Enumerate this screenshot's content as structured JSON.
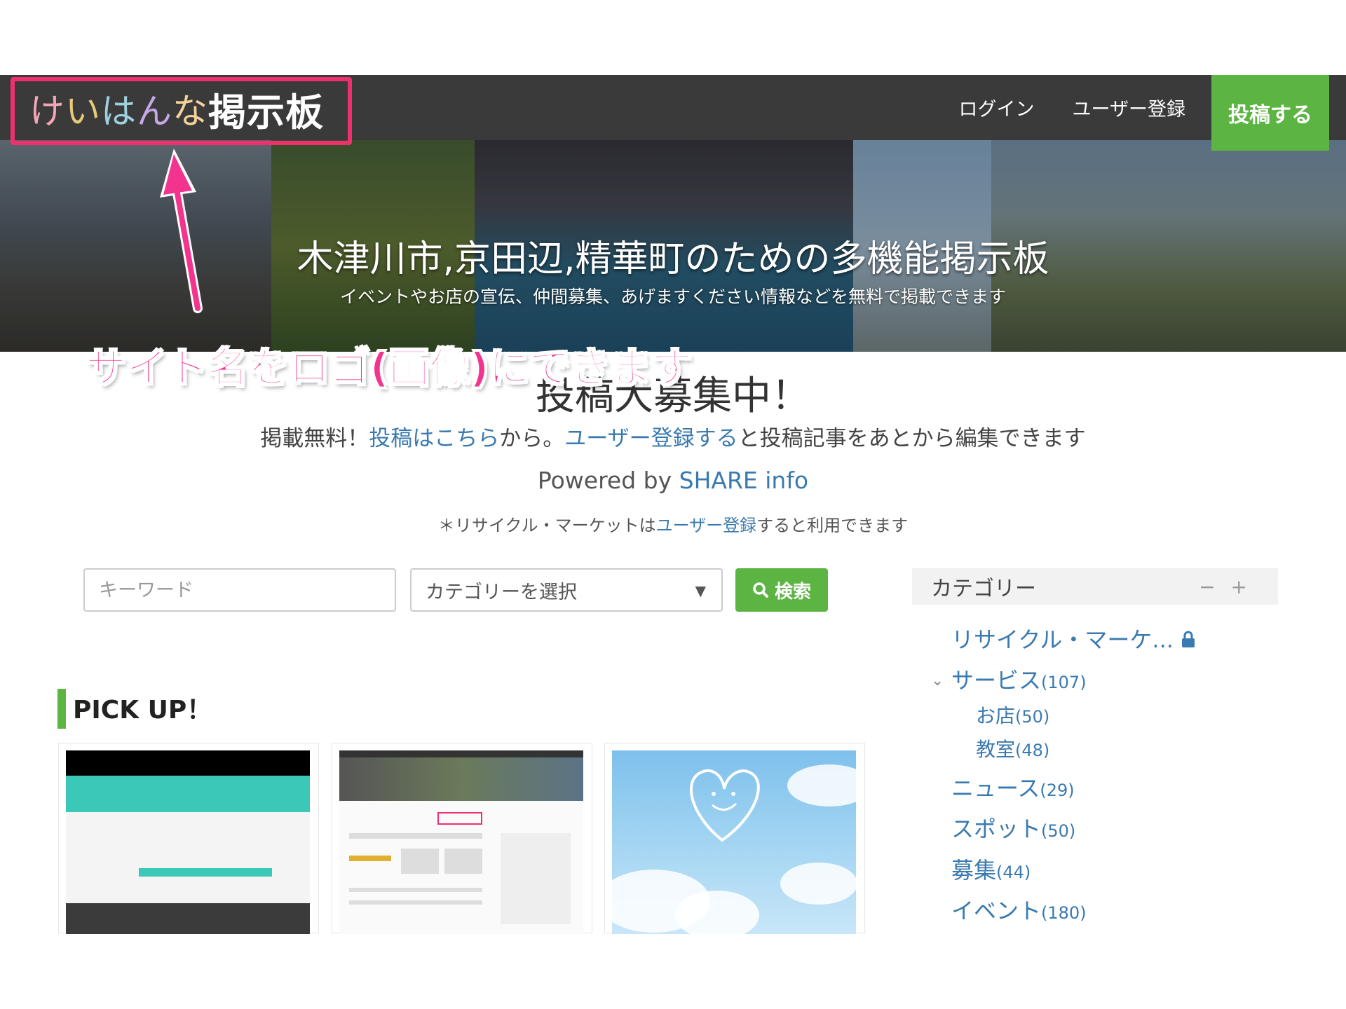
{
  "header": {
    "logo": {
      "part1": "けいはんな",
      "part2": "掲示板"
    },
    "nav": {
      "login": "ログイン",
      "register": "ユーザー登録",
      "post": "投稿する"
    }
  },
  "hero": {
    "title": "木津川市,京田辺,精華町のための多機能掲示板",
    "subtitle": "イベントやお店の宣伝、仲間募集、あげますください情報などを無料で掲載できます"
  },
  "annotation": "サイト名をロゴ(画像)にできます",
  "intro": {
    "title": "投稿大募集中！",
    "line_prefix": "掲載無料！",
    "line_link1": "投稿はこちら",
    "line_mid": "から。",
    "line_link2": "ユーザー登録する",
    "line_suffix": "と投稿記事をあとから編集できます",
    "powered_prefix": "Powered by ",
    "powered_link": "SHARE info",
    "note_prefix": "＊リサイクル・マーケットは",
    "note_link": "ユーザー登録",
    "note_suffix": "すると利用できます"
  },
  "search": {
    "keyword_placeholder": "キーワード",
    "category_selected": "カテゴリーを選択",
    "button_label": "検索"
  },
  "pickup": {
    "title": "PICK UP！"
  },
  "sidebar": {
    "title": "カテゴリー",
    "items": [
      {
        "label": "リサイクル・マーケ...",
        "count": ""
      },
      {
        "label": "サービス",
        "count": "(107)"
      },
      {
        "label": "お店",
        "count": "(50)"
      },
      {
        "label": "教室",
        "count": "(48)"
      },
      {
        "label": "ニュース",
        "count": "(29)"
      },
      {
        "label": "スポット",
        "count": "(50)"
      },
      {
        "label": "募集",
        "count": "(44)"
      },
      {
        "label": "イベント",
        "count": "(180)"
      }
    ]
  },
  "colors": {
    "accent_green": "#5cb443",
    "annotation_pink": "#f2348f",
    "link_blue": "#3a7ab0",
    "header_dark": "#3a3a3a"
  }
}
